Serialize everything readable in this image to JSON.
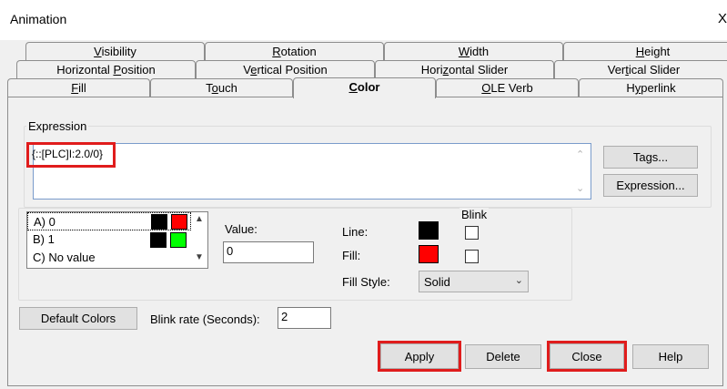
{
  "window": {
    "title": "Animation",
    "close_glyph": "X"
  },
  "tabs_row1": [
    {
      "prefix": "",
      "mnemonic": "V",
      "suffix": "isibility"
    },
    {
      "prefix": "",
      "mnemonic": "R",
      "suffix": "otation"
    },
    {
      "prefix": "",
      "mnemonic": "W",
      "suffix": "idth"
    },
    {
      "prefix": "",
      "mnemonic": "H",
      "suffix": "eight"
    }
  ],
  "tabs_row2": [
    {
      "prefix": "Horizontal ",
      "mnemonic": "P",
      "suffix": "osition"
    },
    {
      "prefix": "V",
      "mnemonic": "e",
      "suffix": "rtical Position"
    },
    {
      "prefix": "Hori",
      "mnemonic": "z",
      "suffix": "ontal Slider"
    },
    {
      "prefix": "Ver",
      "mnemonic": "t",
      "suffix": "ical Slider"
    }
  ],
  "tabs_row3": [
    {
      "prefix": "",
      "mnemonic": "F",
      "suffix": "ill"
    },
    {
      "prefix": "T",
      "mnemonic": "o",
      "suffix": "uch"
    },
    {
      "prefix": "",
      "mnemonic": "C",
      "suffix": "olor"
    },
    {
      "prefix": "",
      "mnemonic": "O",
      "suffix": "LE Verb"
    },
    {
      "prefix": "H",
      "mnemonic": "y",
      "suffix": "perlink"
    }
  ],
  "expression": {
    "group_label": "Expression",
    "value": "{::[PLC]I:2.0/0}"
  },
  "buttons": {
    "tags": "Tags...",
    "expression": "Expression...",
    "default_colors": "Default Colors",
    "apply": "Apply",
    "delete": "Delete",
    "close": "Close",
    "help": "Help"
  },
  "states": [
    {
      "label": "A) 0",
      "line_color": "#000000",
      "fill_color": "#ff0000",
      "selected": true
    },
    {
      "label": "B) 1",
      "line_color": "#000000",
      "fill_color": "#00ff00",
      "selected": false
    },
    {
      "label": "C) No value",
      "selected": false
    }
  ],
  "value_field": {
    "label": "Value:",
    "value": "0"
  },
  "appearance": {
    "blink_label": "Blink",
    "line_label": "Line:",
    "line_color": "#000000",
    "fill_label": "Fill:",
    "fill_color": "#ff0000",
    "fill_style_label": "Fill Style:",
    "fill_style_value": "Solid"
  },
  "blink_rate": {
    "label": "Blink rate (Seconds):",
    "value": "2"
  },
  "highlight_color": "#e01c1c"
}
